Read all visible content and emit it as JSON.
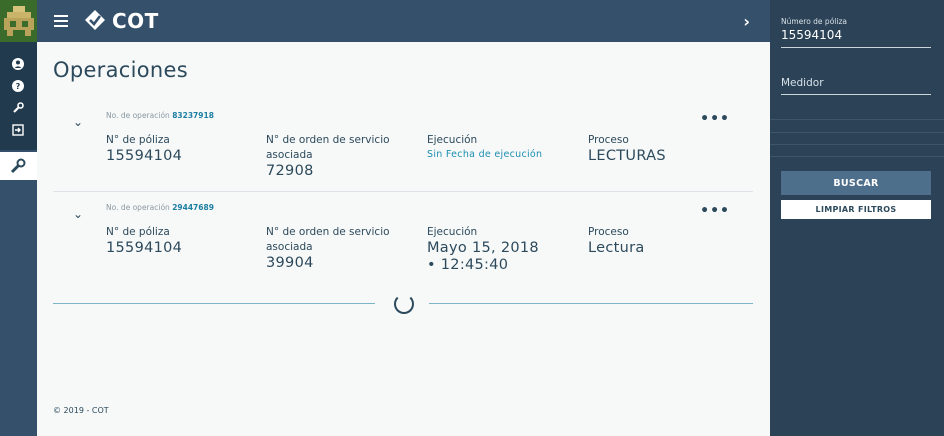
{
  "app": {
    "brand": "COT"
  },
  "page": {
    "title": "Operaciones",
    "footer": "© 2019 - COT"
  },
  "operations": [
    {
      "op_label": "No. de operación",
      "op_number": "83237918",
      "fields": [
        {
          "label": "N° de póliza",
          "value": "15594104"
        },
        {
          "label": "N° de orden de servicio asociada",
          "value": "72908"
        },
        {
          "label": "Ejecución",
          "value": "Sin Fecha de ejecución"
        },
        {
          "label": "Proceso",
          "value": "LECTURAS"
        }
      ]
    },
    {
      "op_label": "No. de operación",
      "op_number": "29447689",
      "fields": [
        {
          "label": "N° de póliza",
          "value": "15594104"
        },
        {
          "label": "N° de orden de servicio asociada",
          "value": "39904"
        },
        {
          "label": "Ejecución",
          "value": "Mayo 15, 2018 • 12:45:40"
        },
        {
          "label": "Proceso",
          "value": "Lectura"
        }
      ]
    }
  ],
  "filters": {
    "poliza_label": "Número de póliza",
    "poliza_value": "15594104",
    "medidor_placeholder": "Medidor",
    "search_button": "BUSCAR",
    "clear_button": "LIMPIAR FILTROS"
  },
  "icons": {
    "logo": "pixel-house-logo",
    "brand_mark": "diamond-logo-icon",
    "menu": "hamburger-menu-icon",
    "collapse": "chevron-right-icon",
    "rail": [
      "user-icon",
      "help-icon",
      "wrench-icon",
      "logout-icon",
      "wrench-icon"
    ],
    "expand": "chevron-down-icon",
    "more": "more-horizontal-icon"
  },
  "colors": {
    "rail": "#34506a",
    "rail_dark": "#213a4d",
    "topbar": "#34506a",
    "sidebar": "#2b4257",
    "accent": "#1c7fa3",
    "search_button": "#4d6f8c"
  }
}
